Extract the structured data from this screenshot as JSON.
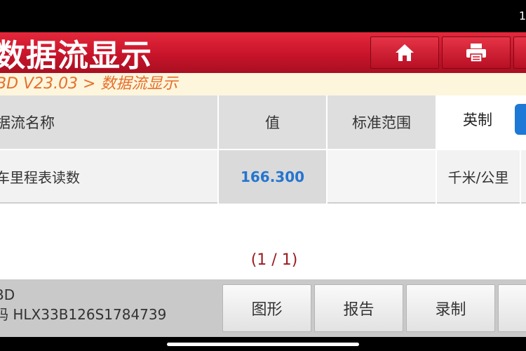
{
  "status_bar": {
    "clock": "1"
  },
  "header": {
    "title": "数据流显示",
    "home_button": {
      "icon": "home-icon"
    },
    "print_button": {
      "icon": "printer-icon"
    }
  },
  "breadcrumb": {
    "path": "BD V23.03 > 数据流显示"
  },
  "table": {
    "columns": {
      "name": "据流名称",
      "value": "值",
      "range": "标准范围"
    },
    "unit_toggle": {
      "label": "英制",
      "active_color": "#1e78d6"
    },
    "rows": [
      {
        "name": "车里程表读数",
        "value": "166.300",
        "range": "",
        "unit": "千米/公里"
      }
    ]
  },
  "pager": {
    "text": "(1 / 1)"
  },
  "footer": {
    "info_line1": "BD",
    "info_line2": "码 HLX33B126S1784739",
    "buttons": {
      "graph": "图形",
      "report": "报告",
      "record": "录制"
    }
  },
  "colors": {
    "header_red": "#c8142a",
    "breadcrumb_text": "#e76e2a",
    "value_blue": "#2475cf",
    "pager_red": "#9b1c22"
  }
}
